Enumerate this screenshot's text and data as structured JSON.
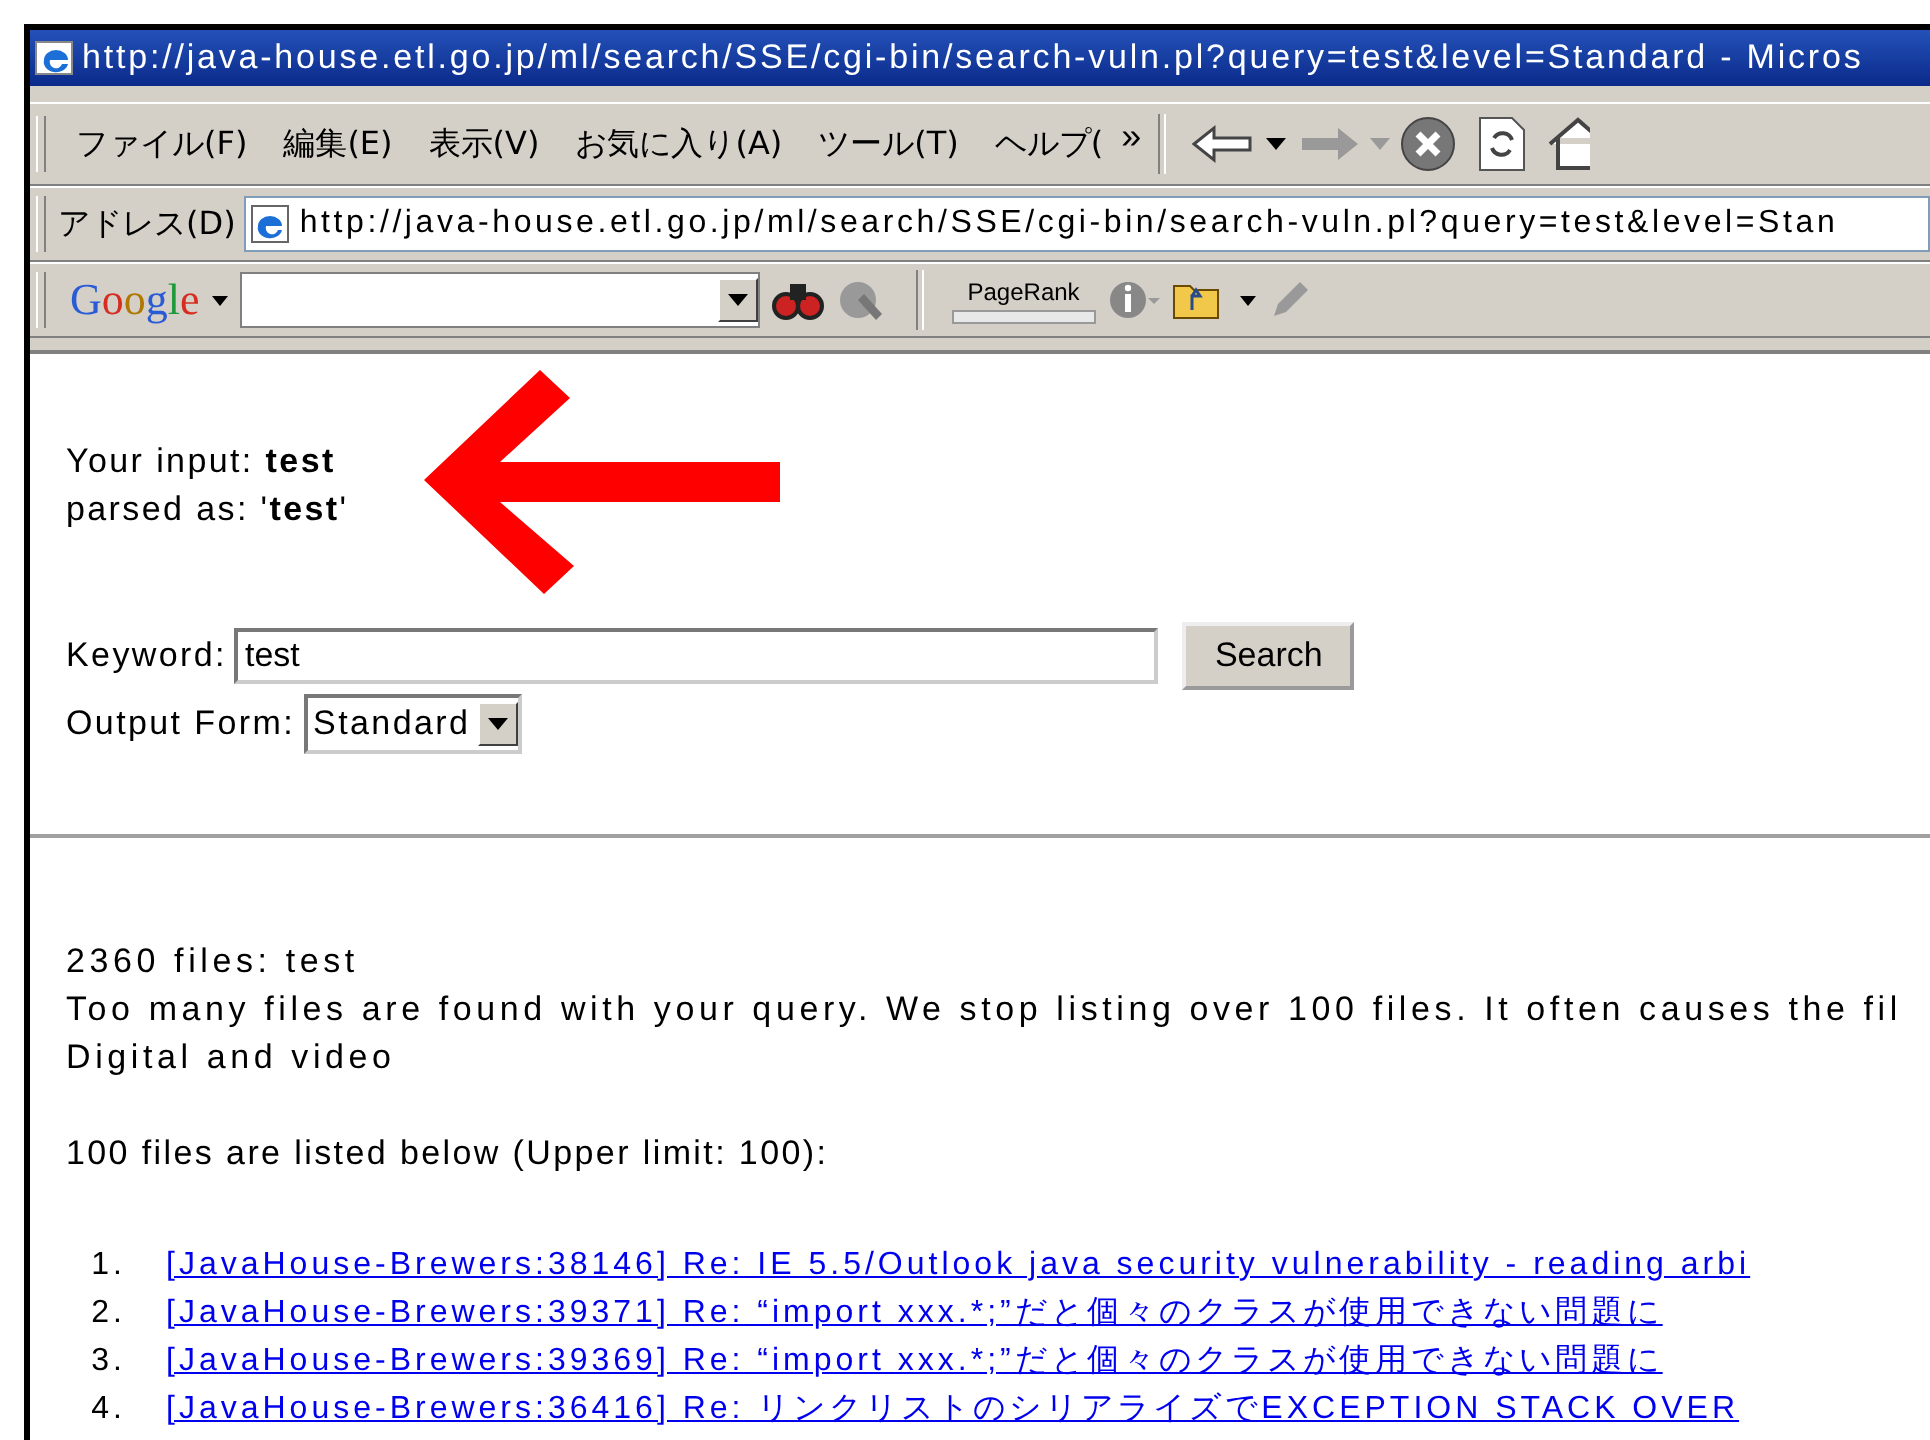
{
  "window": {
    "title": "http://java-house.etl.go.jp/ml/search/SSE/cgi-bin/search-vuln.pl?query=test&level=Standard - Micros"
  },
  "menu": {
    "items": [
      "ファイル(F)",
      "編集(E)",
      "表示(V)",
      "お気に入り(A)",
      "ツール(T)",
      "ヘルプ("
    ],
    "overflow": "»"
  },
  "address_bar": {
    "label": "アドレス(D)",
    "url": "http://java-house.etl.go.jp/ml/search/SSE/cgi-bin/search-vuln.pl?query=test&level=Stan"
  },
  "google_toolbar": {
    "logo": "Google",
    "pagerank_label": "PageRank"
  },
  "page": {
    "input_line": "Your input: **test**",
    "parsed_line": "parsed as: '**test**'",
    "keyword_label": "Keyword:",
    "keyword_value": "test",
    "search_button": "Search",
    "output_label": "Output Form:",
    "output_value": "Standard",
    "summary": [
      "2360 files: test",
      "Too many files are found with your query. We stop listing over 100 files. It often causes the fil",
      "Digital and video"
    ],
    "listed_note": "100 files are listed below (Upper limit: 100):",
    "results": [
      {
        "number": "1.",
        "title": "[JavaHouse-Brewers:38146] Re: IE 5.5/Outlook java security vulnerability - reading arbi"
      },
      {
        "number": "2.",
        "title": "[JavaHouse-Brewers:39371] Re: “import xxx.*;”だと個々のクラスが使用できない問題に"
      },
      {
        "number": "3.",
        "title": "[JavaHouse-Brewers:39369] Re: “import xxx.*;”だと個々のクラスが使用できない問題に"
      },
      {
        "number": "4.",
        "title": "[JavaHouse-Brewers:36416] Re: リンクリストのシリアライズでEXCEPTION STACK OVER"
      }
    ]
  }
}
